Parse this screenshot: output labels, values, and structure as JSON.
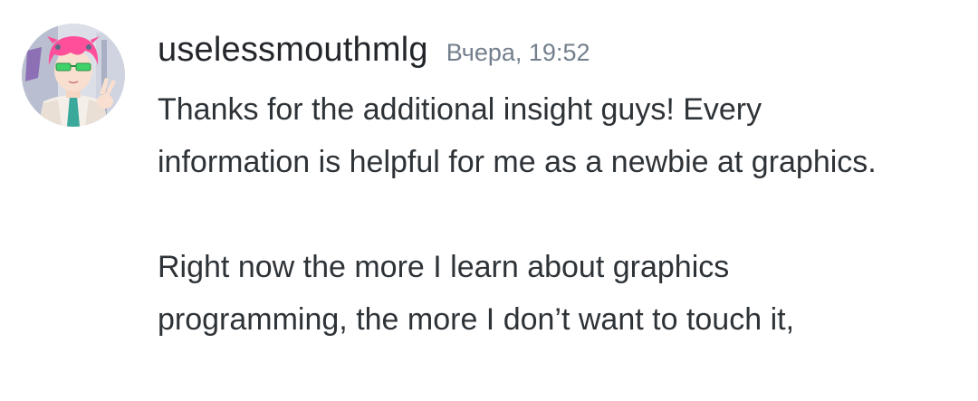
{
  "message": {
    "username": "uselessmouthmlg",
    "timestamp": "Вчера, 19:52",
    "paragraphs": [
      "Thanks for the additional insight guys! Every information is helpful for me as a newbie at graphics.",
      "Right now the more I learn about graphics programming, the more I don’t want to touch it,"
    ]
  },
  "avatar": {
    "icon": "anime-character-avatar",
    "colors": {
      "hair": "#ff4f9a",
      "glasses": "#3fd16a",
      "tie": "#3aa89a",
      "background": "#dcdfe8"
    }
  }
}
